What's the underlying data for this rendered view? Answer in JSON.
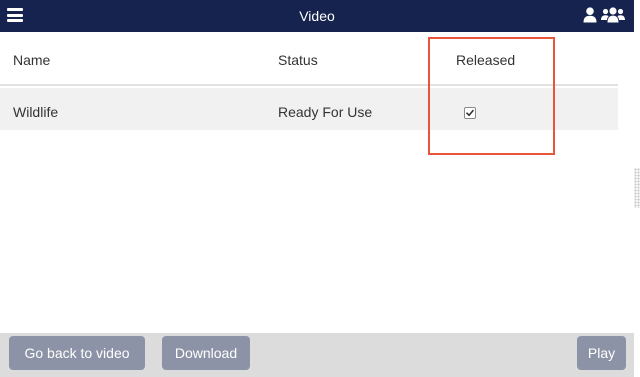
{
  "header": {
    "title": "Video",
    "menu_icon": "hamburger-menu-icon",
    "user_icon": "user-icon",
    "users_icon": "users-group-icon",
    "background_color": "#15234e"
  },
  "table": {
    "columns": [
      "Name",
      "Status",
      "Released"
    ],
    "rows": [
      {
        "name": "Wildlife",
        "status": "Ready For Use",
        "released": true
      }
    ]
  },
  "footer": {
    "back_label": "Go back to video",
    "download_label": "Download",
    "play_label": "Play"
  },
  "colors": {
    "highlight": "#e8543c",
    "button": "#8d93a6",
    "footer_bg": "#dcdcdc",
    "row_bg": "#f1f1f1"
  }
}
